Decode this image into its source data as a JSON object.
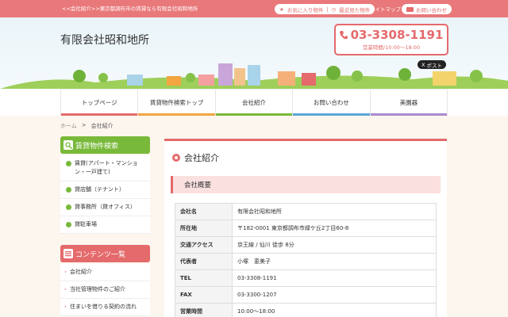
{
  "topbar": {
    "tagline": "<<会社紹介>>東京都調布市の賃貸なら有限会社昭和地所",
    "favorites": "お気に入り物件",
    "recent": "最近見た物件",
    "sitemap": "サイトマップ",
    "contact": "お問い合わせ"
  },
  "header": {
    "company": "有限会社昭和地所",
    "phone": "03-3308-1191",
    "hours": "営業時間/10:00～18:00",
    "post": "ポスト"
  },
  "nav": [
    {
      "label": "トップページ",
      "color": "#e46a6c"
    },
    {
      "label": "賃貸物件検索トップ",
      "color": "#f2a541"
    },
    {
      "label": "会社紹介",
      "color": "#79b93a"
    },
    {
      "label": "お問い合わせ",
      "color": "#5aa6d6"
    },
    {
      "label": "美園器",
      "color": "#a98bcf"
    }
  ],
  "breadcrumb": {
    "home": "ホーム",
    "sep": ">",
    "current": "会社紹介"
  },
  "sidebar": {
    "search_title": "賃貸物件検索",
    "search_items": [
      "賃貸(アパート・マンション・一戸建て)",
      "貸店舗（テナント）",
      "貸事務所（貸オフィス）",
      "貸駐車場"
    ],
    "contents_title": "コンテンツ一覧",
    "contents_items": [
      "会社紹介",
      "当社管理物件のご紹介",
      "住まいを借りる契約の流れ"
    ]
  },
  "main": {
    "title": "会社紹介",
    "subhead": "会社概要",
    "rows": [
      {
        "k": "会社名",
        "v": "有限会社昭和地所"
      },
      {
        "k": "所在地",
        "v": "〒182-0001 東京都調布市緑ケ丘2丁目60-8"
      },
      {
        "k": "交通アクセス",
        "v": "京王線 / 仙川 徒歩 8分"
      },
      {
        "k": "代表者",
        "v": "小塚　恵美子"
      },
      {
        "k": "TEL",
        "v": "03-3308-1191"
      },
      {
        "k": "FAX",
        "v": "03-3300-1207"
      },
      {
        "k": "営業時間",
        "v": "10:00～18:00"
      }
    ]
  },
  "colors": {
    "accent": "#e46a6c",
    "green": "#79b93a",
    "pink": "#f08a8c"
  }
}
